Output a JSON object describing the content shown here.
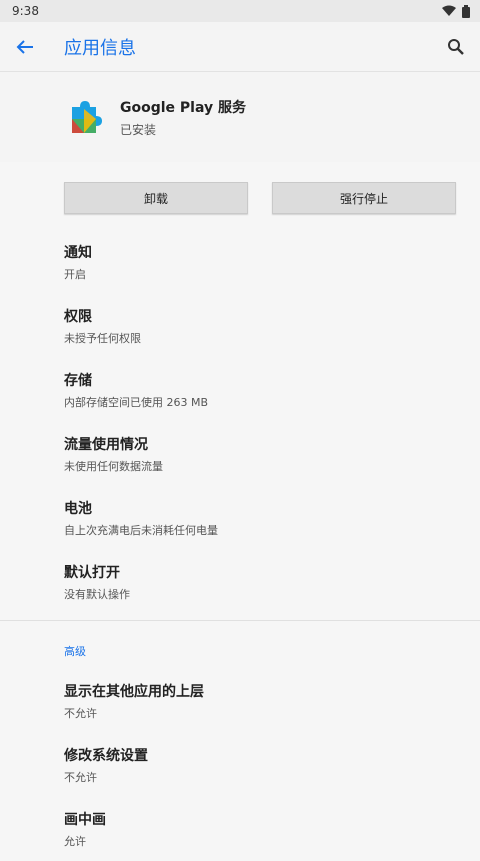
{
  "status_bar": {
    "time": "9:38"
  },
  "toolbar": {
    "title": "应用信息"
  },
  "app": {
    "name": "Google Play 服务",
    "status": "已安装"
  },
  "buttons": {
    "uninstall": "卸载",
    "force_stop": "强行停止"
  },
  "items": [
    {
      "label": "通知",
      "sub": "开启"
    },
    {
      "label": "权限",
      "sub": "未授予任何权限"
    },
    {
      "label": "存储",
      "sub": "内部存储空间已使用 263 MB"
    },
    {
      "label": "流量使用情况",
      "sub": "未使用任何数据流量"
    },
    {
      "label": "电池",
      "sub": "自上次充满电后未消耗任何电量"
    },
    {
      "label": "默认打开",
      "sub": "没有默认操作"
    }
  ],
  "advanced": {
    "header": "高级",
    "items": [
      {
        "label": "显示在其他应用的上层",
        "sub": "不允许"
      },
      {
        "label": "修改系统设置",
        "sub": "不允许"
      },
      {
        "label": "画中画",
        "sub": "允许"
      }
    ]
  },
  "colors": {
    "accent": "#1a73e8"
  },
  "icons": {
    "back": "arrow-left-icon",
    "search": "search-icon",
    "wifi": "wifi-icon",
    "battery": "battery-icon",
    "app": "puzzle-piece-icon"
  }
}
